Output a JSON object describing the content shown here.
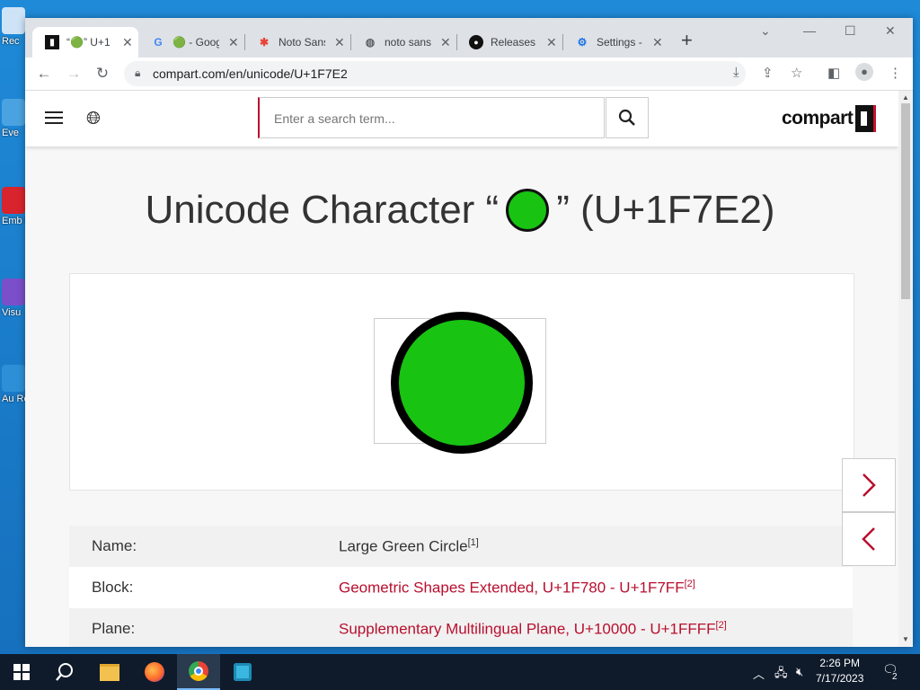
{
  "desktop": {
    "icons": [
      {
        "label": "Rec",
        "color": "#cfe3f7"
      },
      {
        "label": "Eve",
        "color": "#4aa3e0"
      },
      {
        "label": "Emb De",
        "color": "#d8242c"
      },
      {
        "label": "Visu",
        "color": "#7a4fc9"
      },
      {
        "label": "Au Re",
        "color": "#2d8fd6"
      }
    ]
  },
  "browser": {
    "tabs": [
      {
        "title": "“🟢” U+1",
        "icon": "compart-favicon",
        "active": true
      },
      {
        "title": "🟢 - Googl",
        "icon": "google-favicon"
      },
      {
        "title": "Noto Sans",
        "icon": "noto-favicon"
      },
      {
        "title": "noto sans",
        "icon": "globe-favicon"
      },
      {
        "title": "Releases",
        "icon": "github-favicon"
      },
      {
        "title": "Settings -",
        "icon": "settings-favicon"
      }
    ],
    "url": "compart.com/en/unicode/U+1F7E2"
  },
  "site": {
    "search_placeholder": "Enter a search term...",
    "logo_text": "compart"
  },
  "page": {
    "title_prefix": "Unicode Character “",
    "title_suffix": "” (U+1F7E2)",
    "glyph_color": "#18c312"
  },
  "info_rows": [
    {
      "key": "Name:",
      "value": "Large Green Circle",
      "ref": "[1]",
      "link": false
    },
    {
      "key": "Block:",
      "value": "Geometric Shapes Extended, U+1F780 - U+1F7FF",
      "ref": "[2]",
      "link": true
    },
    {
      "key": "Plane:",
      "value": "Supplementary Multilingual Plane, U+10000 - U+1FFFF",
      "ref": "[2]",
      "link": true
    }
  ],
  "taskbar": {
    "time": "2:26 PM",
    "date": "7/17/2023",
    "notifications": "2"
  }
}
